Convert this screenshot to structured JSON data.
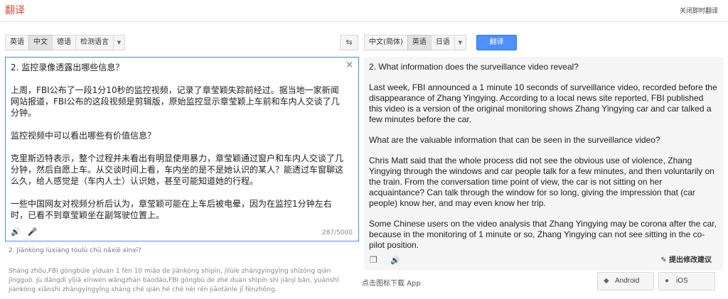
{
  "header": {
    "title": "翻译",
    "close_instant": "关闭即时翻译"
  },
  "source_langs": [
    "英语",
    "中文",
    "德语",
    "检测语言"
  ],
  "swap_icon": "⇆",
  "target_langs": [
    "中文(简体)",
    "英语",
    "日语"
  ],
  "translate_button": "翻译",
  "source": {
    "paragraphs": [
      "2. 监控录像透露出哪些信息？",
      "上周，FBI公布了一段1分10秒的监控视频，记录了章莹颖失踪前经过。据当地一家新闻网站报道，FBI公布的这段视频是剪辑版，原始监控显示章莹颖上车前和车内人交谈了几分钟。",
      "监控视频中可以看出哪些有价值信息？",
      "克里斯迈特表示，整个过程并未看出有明显使用暴力，章莹颖通过窗户和车内人交谈了几分钟，然后自愿上车。从交谈时间上看，车内坐的是不是她认识的某人？能透过车窗聊这么久，给人感觉是（车内人士）认识她，甚至可能知道她的行程。",
      "一些中国网友对视频分析后认为，章莹颖可能在上车后被电晕，因为在监控1分钟左右时，已看不到章莹颖坐在副驾驶位置上。"
    ],
    "counter": "287/5000",
    "clear_icon": "×"
  },
  "translit": {
    "question": "2. Jiānkòng lùxiàng tòulù chū nǎxiē xìnxī?",
    "body": "Shàng zhōu,FBI gōngbùle yīduàn 1 fēn 10 miǎo de jiānkòng shìpín, jìlùle zhāngyíngyǐng shīzōng qián jīngguò. Jù dāngdì yījiā xīnwén wǎngzhàn bàodào,FBI gōngbù de zhè duàn shìpín shì jiǎnjí bǎn, yuánshǐ jiānkòng xiǎnshì zhāngyíngyǐng shàng chē qián hé chē nèi rén jiāotánle jǐ fēnzhōng."
  },
  "result": {
    "paragraphs": [
      "2. What information does the surveillance video reveal?",
      "Last week, FBI announced a 1 minute 10 seconds of surveillance video, recorded before the disappearance of Zhang Yingying. According to a local news site reported, FBI published this video is a version of the original monitoring shows Zhang Yingying car and car talked a few minutes before the car.",
      "What are the valuable information that can be seen in the surveillance video?",
      "Chris Matt said that the whole process did not see the obvious use of violence, Zhang Yingying through the windows and car people talk for a few minutes, and then voluntarily on the train. From the conversation time point of view, the car is not sitting on her acquaintance? Can talk through the window for so long, giving the impression that (car people) know her, and may even know her trip.",
      "Some Chinese users on the video analysis that Zhang Yingying may be corona after the car, because in the monitoring of 1 minute or so, Zhang Yingying can not see sitting in the co-pilot position."
    ],
    "suggest": "提出修改建议"
  },
  "app_download": "点击图标下载 App",
  "stores": [
    "Android",
    "iOS"
  ]
}
